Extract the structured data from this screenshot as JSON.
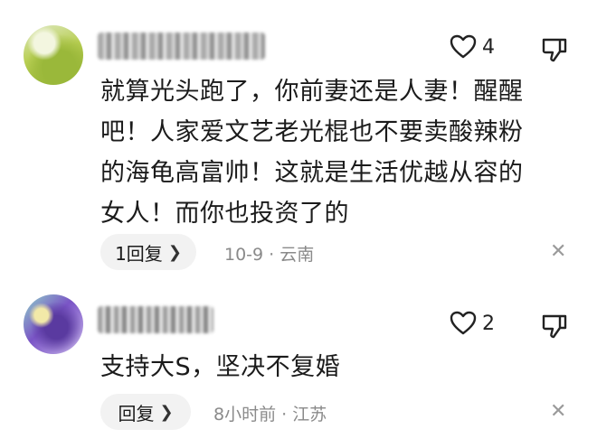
{
  "comments": [
    {
      "like_count": "4",
      "text": "就算光头跑了，你前妻还是人妻！醒醒\n吧！人家爱文艺老光棍也不要卖酸辣粉\n的海龟高富帅！这就是生活优越从容的\n女人！而你也投资了的",
      "reply_label": "1回复",
      "meta": "10-9 · 云南"
    },
    {
      "like_count": "2",
      "text": "支持大S，坚决不复婚",
      "reply_label": "回复",
      "meta": "8小时前 · 江苏"
    }
  ],
  "icons": {
    "like": "heart-outline-icon",
    "dislike": "thumb-down-icon",
    "expand": "chevron-right-icon",
    "close": "close-icon"
  }
}
